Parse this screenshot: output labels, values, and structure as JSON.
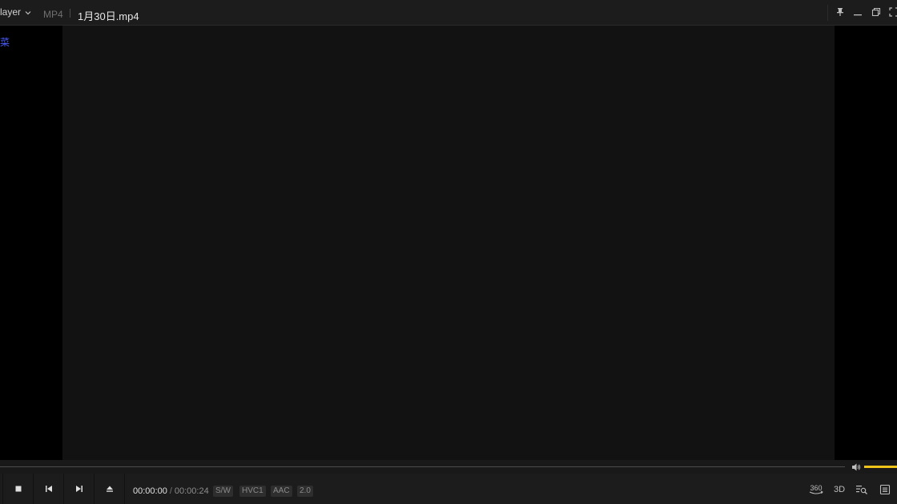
{
  "titlebar": {
    "app_name": "layer",
    "format": "MP4",
    "file_title": "1月30日.mp4"
  },
  "content": {
    "left_glyph": "菜"
  },
  "controls": {
    "time_current": "00:00:00",
    "time_separator": "/",
    "time_total": "00:00:24",
    "badges": [
      "S/W",
      "HVC1",
      "AAC",
      "2.0"
    ],
    "tool_360_label": "360",
    "tool_3d_label": "3D",
    "volume_level": 1.0
  },
  "colors": {
    "accent": "#f0c419",
    "background": "#1c1c1c",
    "video_area": "#121212"
  },
  "icons": [
    "chevron-down-icon",
    "pin-icon",
    "minimize-icon",
    "restore-icon",
    "fullscreen-icon",
    "stop-icon",
    "previous-icon",
    "next-icon",
    "eject-icon",
    "volume-icon",
    "360-video-icon",
    "3d-icon",
    "search-list-icon",
    "playlist-icon"
  ]
}
